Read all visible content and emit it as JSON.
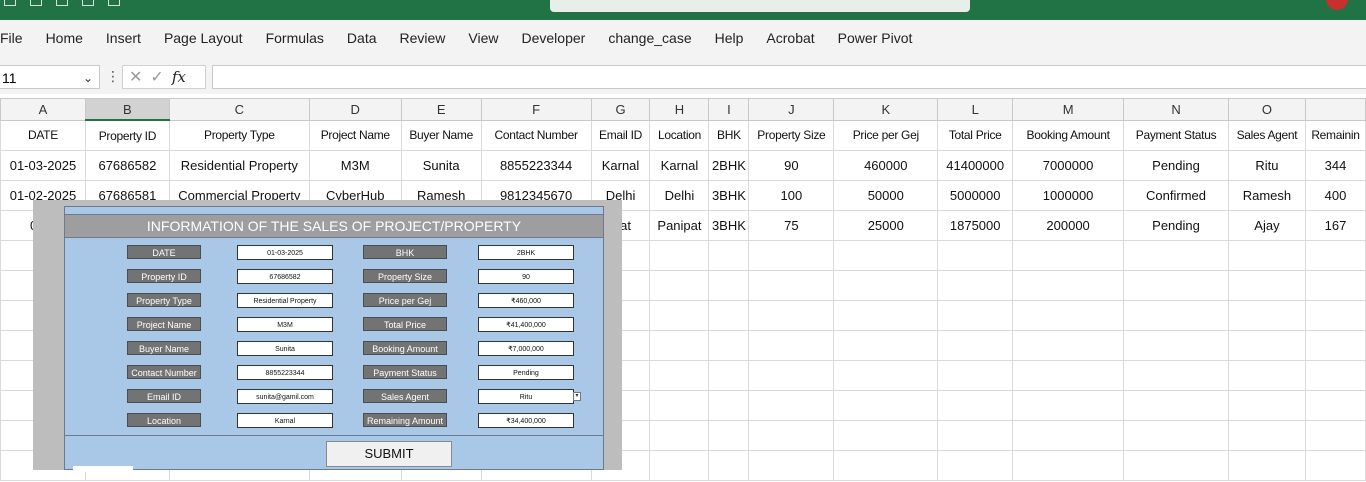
{
  "ribbon": {
    "tabs": [
      "File",
      "Home",
      "Insert",
      "Page Layout",
      "Formulas",
      "Data",
      "Review",
      "View",
      "Developer",
      "change_case",
      "Help",
      "Acrobat",
      "Power Pivot"
    ]
  },
  "formula_bar": {
    "name_box": "11",
    "fx": "fx",
    "formula": ""
  },
  "sheet": {
    "columns": [
      "A",
      "B",
      "C",
      "D",
      "E",
      "F",
      "G",
      "H",
      "I",
      "J",
      "K",
      "L",
      "M",
      "N",
      "O",
      ""
    ],
    "selected_column": "B",
    "headers": [
      "DATE",
      "Property ID",
      "Property Type",
      "Project Name",
      "Buyer Name",
      "Contact Number",
      "Email ID",
      "Location",
      "BHK",
      "Property Size",
      "Price per Gej",
      "Total Price",
      "Booking Amount",
      "Payment Status",
      "Sales Agent",
      "Remainin"
    ],
    "rows": [
      [
        "01-03-2025",
        "67686582",
        "Residential Property",
        "M3M",
        "Sunita",
        "8855223344",
        "Karnal",
        "Karnal",
        "2BHK",
        "90",
        "460000",
        "41400000",
        "7000000",
        "Pending",
        "Ritu",
        "344"
      ],
      [
        "01-02-2025",
        "67686581",
        "Commercial Property",
        "CyberHub",
        "Ramesh",
        "9812345670",
        "Delhi",
        "Delhi",
        "3BHK",
        "100",
        "50000",
        "5000000",
        "1000000",
        "Confirmed",
        "Ramesh",
        "400"
      ],
      [
        "01-0",
        "",
        "",
        "",
        "",
        "",
        "ipat",
        "Panipat",
        "3BHK",
        "75",
        "25000",
        "1875000",
        "200000",
        "Pending",
        "Ajay",
        "167"
      ]
    ]
  },
  "form": {
    "title": "INFORMATION OF THE SALES OF PROJECT/PROPERTY",
    "left_fields": [
      {
        "label": "DATE",
        "value": "01-03-2025"
      },
      {
        "label": "Property ID",
        "value": "67686582"
      },
      {
        "label": "Property Type",
        "value": "Residential Property"
      },
      {
        "label": "Project Name",
        "value": "M3M"
      },
      {
        "label": "Buyer Name",
        "value": "Sunita"
      },
      {
        "label": "Contact Number",
        "value": "8855223344"
      },
      {
        "label": "Email ID",
        "value": "sunita@gamil.com"
      },
      {
        "label": "Location",
        "value": "Karnal"
      }
    ],
    "right_fields": [
      {
        "label": "BHK",
        "value": "2BHK"
      },
      {
        "label": "Property Size",
        "value": "90"
      },
      {
        "label": "Price per Gej",
        "value": "₹460,000"
      },
      {
        "label": "Total Price",
        "value": "₹41,400,000"
      },
      {
        "label": "Booking Amount",
        "value": "₹7,000,000"
      },
      {
        "label": "Payment Status",
        "value": "Pending"
      },
      {
        "label": "Sales Agent",
        "value": "Ritu"
      },
      {
        "label": "Remaining Amount",
        "value": "₹34,400,000"
      }
    ],
    "dropdown_glyph": "▾",
    "submit_label": "SUBMIT"
  }
}
